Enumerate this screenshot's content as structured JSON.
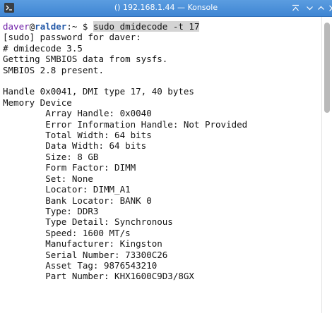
{
  "window": {
    "title": "() 192.168.1.44 — Konsole"
  },
  "terminal": {
    "prompt_user": "daver",
    "prompt_at": "@",
    "prompt_host": "ralder",
    "prompt_path": ":~ $ ",
    "command": "sudo dmidecode -t 17",
    "output_lines": [
      "[sudo] password for daver:",
      "# dmidecode 3.5",
      "Getting SMBIOS data from sysfs.",
      "SMBIOS 2.8 present.",
      "",
      "Handle 0x0041, DMI type 17, 40 bytes",
      "Memory Device",
      "        Array Handle: 0x0040",
      "        Error Information Handle: Not Provided",
      "        Total Width: 64 bits",
      "        Data Width: 64 bits",
      "        Size: 8 GB",
      "        Form Factor: DIMM",
      "        Set: None",
      "        Locator: DIMM_A1",
      "        Bank Locator: BANK 0",
      "        Type: DDR3",
      "        Type Detail: Synchronous",
      "        Speed: 1600 MT/s",
      "        Manufacturer: Kingston",
      "        Serial Number: 73300C26",
      "        Asset Tag: 9876543210",
      "        Part Number: KHX1600C9D3/8GX"
    ]
  },
  "colors": {
    "titlebar": "#4a90d9",
    "user": "#6f1fa8",
    "host": "#2258a8",
    "text": "#141414",
    "command_highlight": "#d4d4d4"
  },
  "icons": {
    "app": "terminal-icon",
    "keep_above": "keep-above-icon",
    "minimize": "minimize-icon",
    "maximize": "maximize-icon",
    "close": "close-icon"
  }
}
